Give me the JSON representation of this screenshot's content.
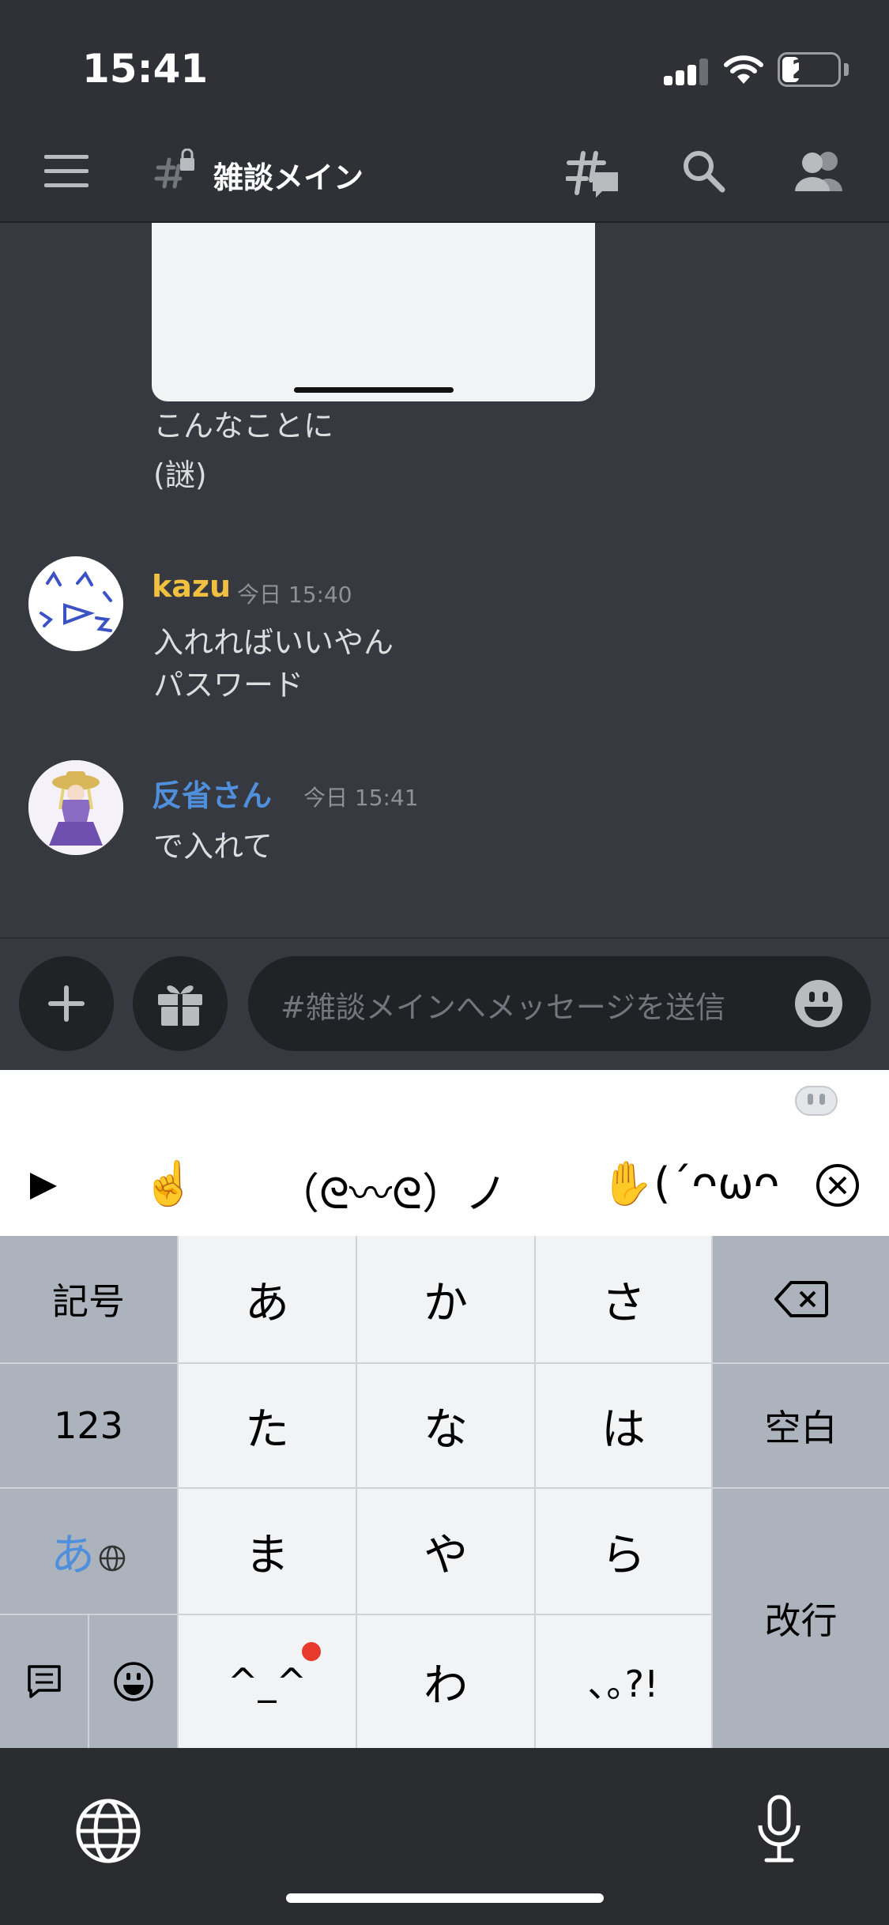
{
  "status_bar": {
    "time": "15:41",
    "battery": "22"
  },
  "header": {
    "channel_name": "雑談メイン"
  },
  "messages": [
    {
      "lines": [
        "こんなことに",
        "(謎)"
      ]
    },
    {
      "author": "kazu",
      "author_color": "#f0c040",
      "timestamp": "今日 15:40",
      "lines": [
        "入れればいいやん",
        "パスワード"
      ]
    },
    {
      "author": "反省さん",
      "author_color": "#4f8fdb",
      "timestamp": "今日 15:41",
      "lines": [
        "で入れて"
      ]
    }
  ],
  "composer": {
    "placeholder": "#雑談メインへメッセージを送信"
  },
  "suggestions": [
    "☝️",
    "（ᘓ〰ᘓ）ノ",
    "✋(´ᴖωᴖ"
  ],
  "keyboard": {
    "symbols": "記号",
    "numbers": "123",
    "kana_switch": "あ",
    "row1": [
      "あ",
      "か",
      "さ"
    ],
    "row2": [
      "た",
      "な",
      "は"
    ],
    "row3": [
      "ま",
      "や",
      "ら"
    ],
    "row4": [
      "^_^",
      "わ",
      "､｡?!"
    ],
    "space": "空白",
    "enter": "改行"
  },
  "colors": {
    "background": "#36393f",
    "header": "#2f3136",
    "link_blue": "#4f8fdb",
    "notification_red": "#e8392d"
  }
}
